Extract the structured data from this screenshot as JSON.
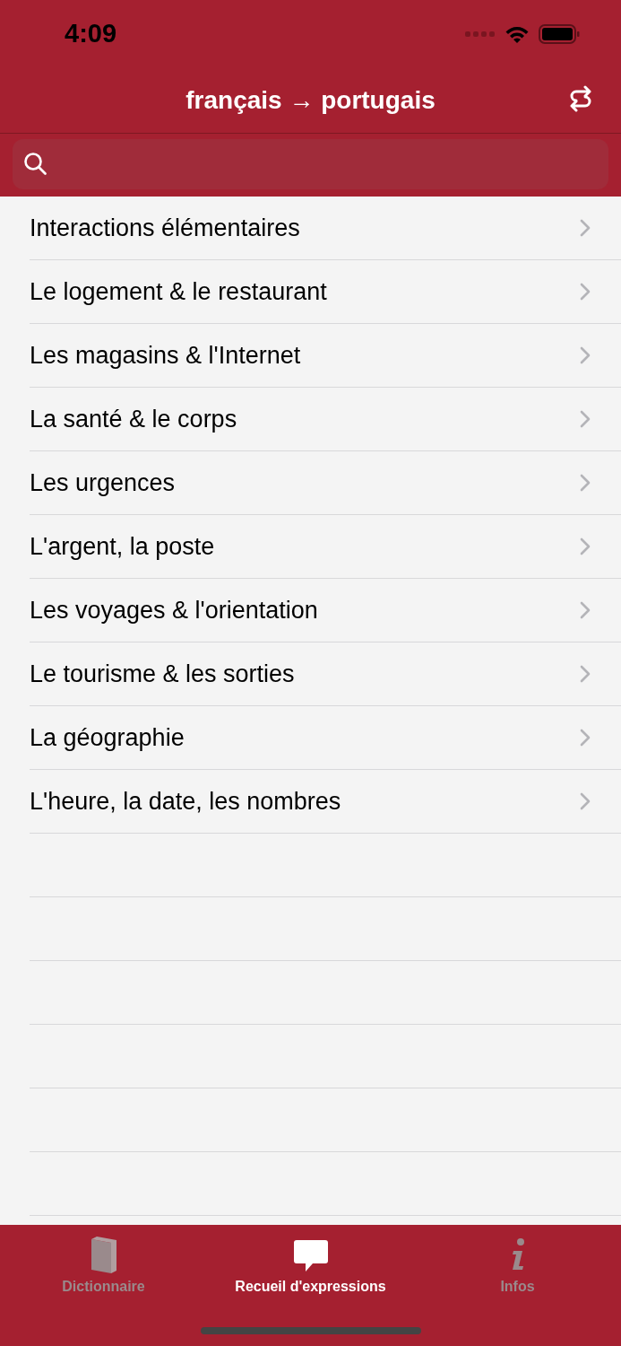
{
  "status_bar": {
    "time": "4:09"
  },
  "nav": {
    "title": "français → portugais"
  },
  "topics": [
    {
      "label": "Interactions élémentaires"
    },
    {
      "label": "Le logement & le restaurant"
    },
    {
      "label": "Les magasins & l'Internet"
    },
    {
      "label": "La santé & le corps"
    },
    {
      "label": "Les urgences"
    },
    {
      "label": "L'argent, la poste"
    },
    {
      "label": "Les voyages & l'orientation"
    },
    {
      "label": "Le tourisme & les sorties"
    },
    {
      "label": "La géographie"
    },
    {
      "label": "L'heure, la date, les nombres"
    }
  ],
  "tabs": [
    {
      "label": "Dictionnaire",
      "kind": "book",
      "selected": false
    },
    {
      "label": "Recueil d'expressions",
      "kind": "bubble",
      "selected": true
    },
    {
      "label": "Infos",
      "kind": "info",
      "selected": false
    }
  ]
}
